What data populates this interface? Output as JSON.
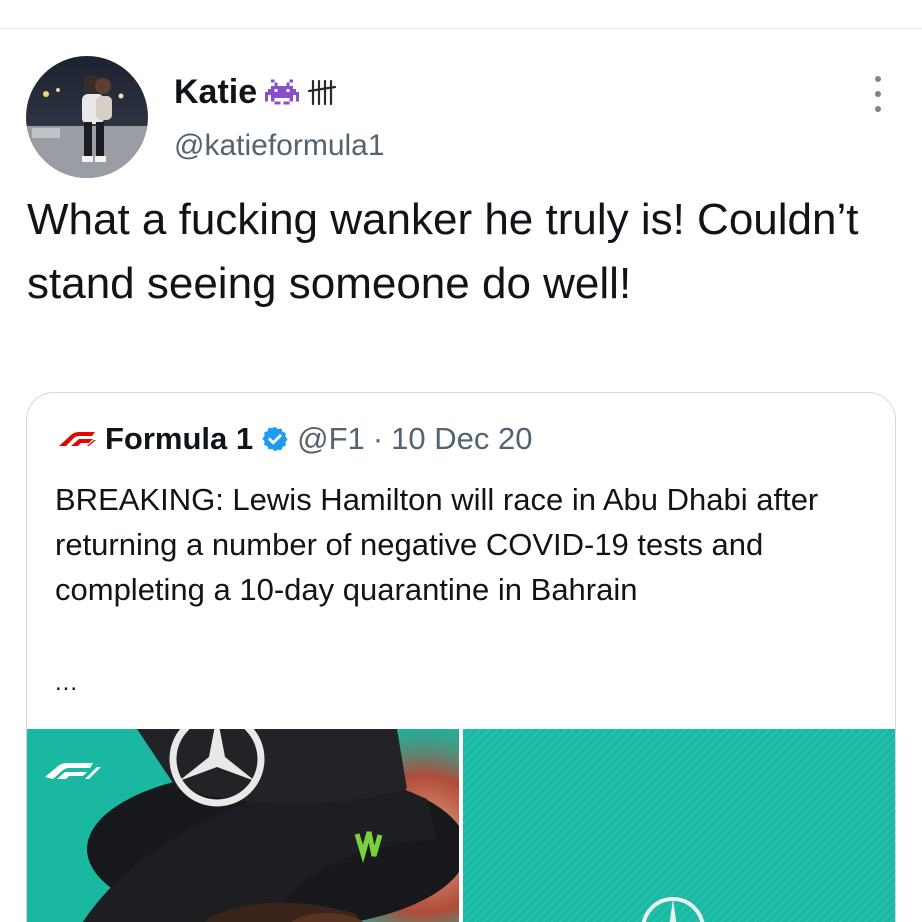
{
  "tweet": {
    "display_name": "Katie",
    "name_emojis": [
      "space-invader-icon",
      "tally-marks-icon"
    ],
    "handle": "@katieformula1",
    "text": "What a fucking wanker he truly is! Couldn’t stand seeing someone do well!",
    "more_icon": "more-options-icon"
  },
  "quote": {
    "logo_icon": "f1-logo-icon",
    "name": "Formula 1",
    "verified_icon": "verified-badge-icon",
    "handle": "@F1",
    "separator": "·",
    "date": "10 Dec 20",
    "text": "BREAKING: Lewis Hamilton will race in Abu Dhabi after returning a number of negative COVID-19 tests and completing a 10-day quarantine in Bahrain",
    "ellipsis": "..."
  },
  "colors": {
    "text": "#0f1419",
    "secondary": "#536471",
    "border": "#cfd9de",
    "verified": "#1d9bf0",
    "teal": "#1ab7a1"
  }
}
